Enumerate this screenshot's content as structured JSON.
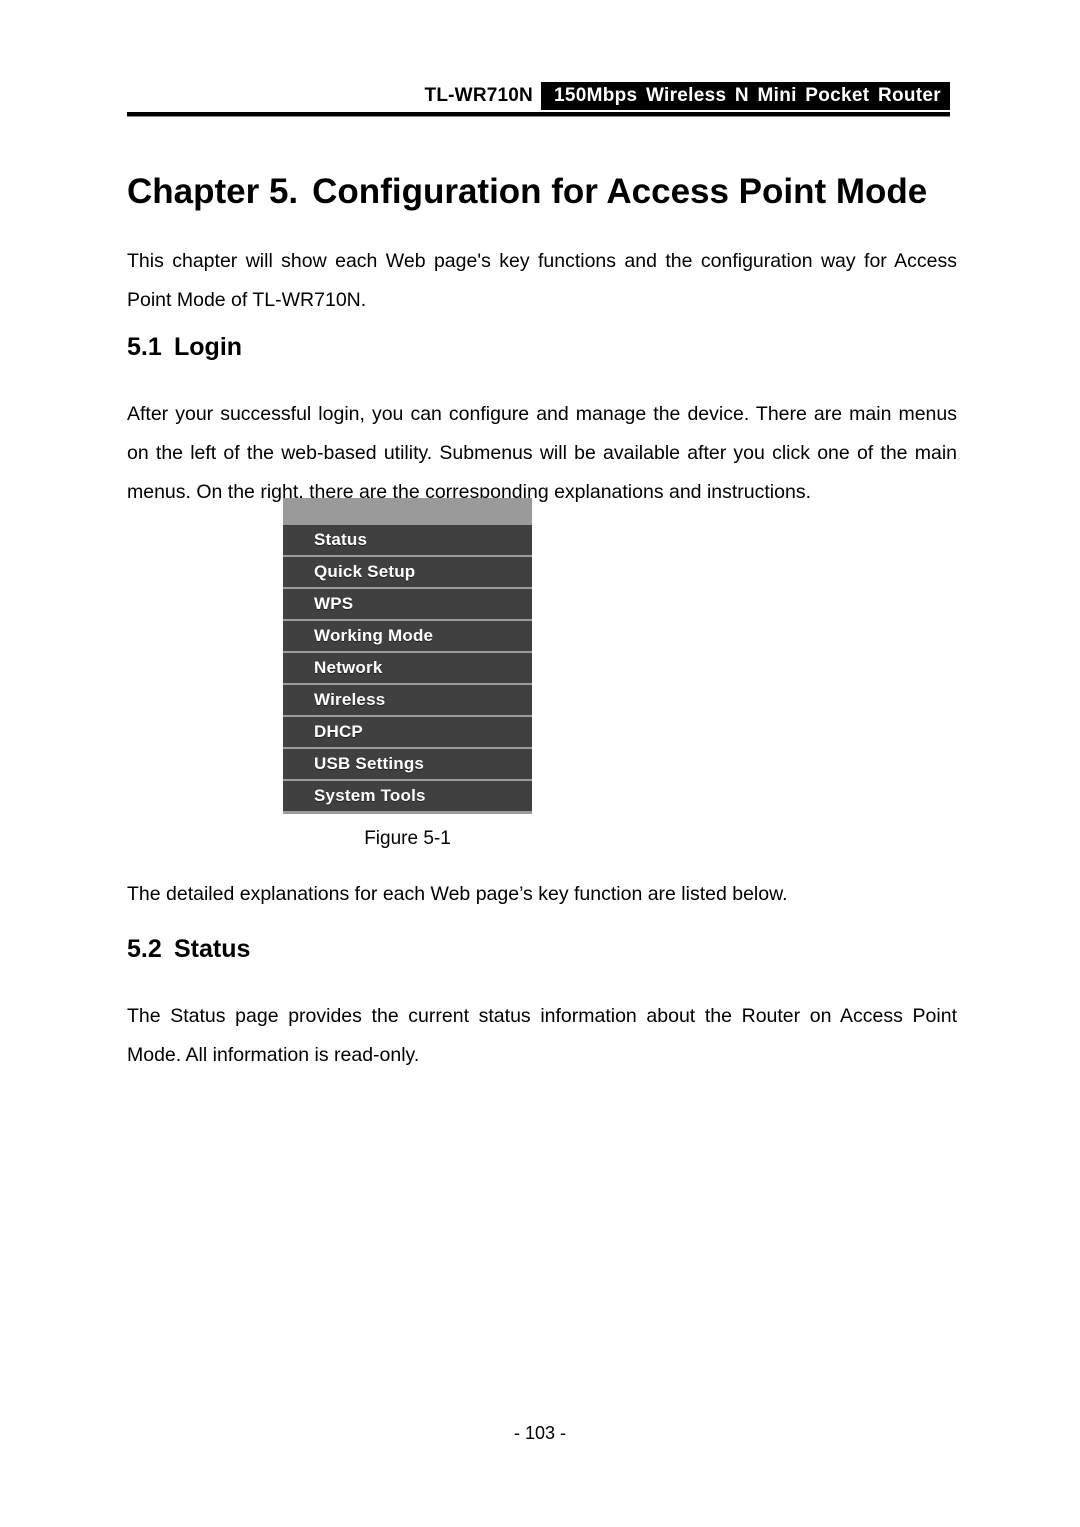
{
  "header": {
    "model": "TL-WR710N",
    "product_band": "150Mbps Wireless N Mini Pocket Router",
    "band_background": "#000000",
    "band_text_color": "#ffffff"
  },
  "chapter": {
    "number_label": "Chapter 5.",
    "title": "Configuration for Access Point Mode"
  },
  "paragraphs": {
    "intro": "This chapter will show each Web page's key functions and the configuration way for Access Point Mode of TL-WR710N.",
    "login": "After your successful login, you can configure and manage the device. There are main menus on the left of the web-based utility. Submenus will be available after you click one of the main menus. On the right, there are the corresponding explanations and instructions.",
    "after_figure": "The detailed explanations for each Web page’s key function are listed below.",
    "status": "The Status page provides the current status information about the Router on Access Point Mode. All information is read-only."
  },
  "sections": [
    {
      "number": "5.1",
      "title": "Login"
    },
    {
      "number": "5.2",
      "title": "Status"
    }
  ],
  "figure": {
    "caption": "Figure 5-1",
    "menu_background": "#404040",
    "menu_divider_color": "#999999",
    "menu_text_color": "#ffffff",
    "items": [
      {
        "label": "Status"
      },
      {
        "label": "Quick Setup"
      },
      {
        "label": "WPS"
      },
      {
        "label": "Working Mode"
      },
      {
        "label": "Network"
      },
      {
        "label": "Wireless"
      },
      {
        "label": "DHCP"
      },
      {
        "label": "USB Settings"
      },
      {
        "label": "System Tools"
      }
    ]
  },
  "footer": {
    "page_number": "- 103 -"
  }
}
